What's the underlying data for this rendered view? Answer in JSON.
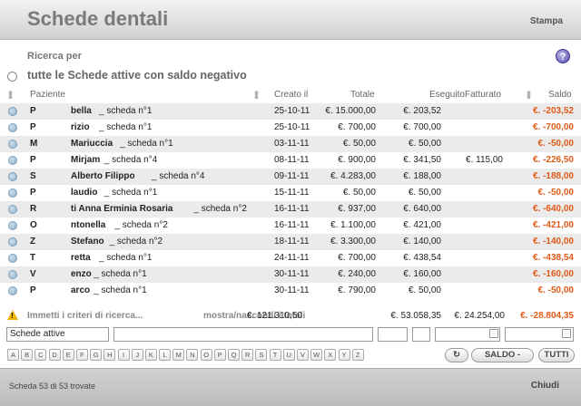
{
  "header": {
    "title": "Schede dentali",
    "print_label": "Stampa"
  },
  "search": {
    "label": "Ricerca per",
    "help_icon": "question-help-icon",
    "option_label": "tutte le Schede attive con saldo negativo"
  },
  "columns": {
    "patient": "Paziente",
    "created": "Creato il",
    "total": "Totale",
    "done": "Eseguito",
    "billed": "Fatturato",
    "balance": "Saldo"
  },
  "rows": [
    {
      "initial": "P",
      "name": "bella",
      "scheda": " _ scheda n°1",
      "created": "25-10-11",
      "total": "€. 15.000,00",
      "done": "€. 203,52",
      "billed": "",
      "balance": "€. -203,52"
    },
    {
      "initial": "P",
      "name": "rizio",
      "scheda": " _ scheda n°1",
      "created": "25-10-11",
      "total": "€. 700,00",
      "done": "€. 700,00",
      "billed": "",
      "balance": "€. -700,00"
    },
    {
      "initial": "M",
      "name": "Mariuccia",
      "scheda": " _ scheda n°1",
      "created": "03-11-11",
      "total": "€. 50,00",
      "done": "€. 50,00",
      "billed": "",
      "balance": "€. -50,00"
    },
    {
      "initial": "P",
      "name": "Mirjam",
      "scheda": " _ scheda n°4",
      "created": "08-11-11",
      "total": "€. 900,00",
      "done": "€. 341,50",
      "billed": "€. 115,00",
      "balance": "€. -226,50"
    },
    {
      "initial": "S",
      "name": "Alberto Filippo",
      "scheda": " _ scheda n°4",
      "created": "09-11-11",
      "total": "€. 4.283,00",
      "done": "€. 188,00",
      "billed": "",
      "balance": "€. -188,00"
    },
    {
      "initial": "P",
      "name": "laudio",
      "scheda": " _ scheda n°1",
      "created": "15-11-11",
      "total": "€. 50,00",
      "done": "€. 50,00",
      "billed": "",
      "balance": "€. -50,00"
    },
    {
      "initial": "R",
      "name": "ti Anna Erminia Rosaria",
      "scheda": " _ scheda n°2",
      "created": "16-11-11",
      "total": "€. 937,00",
      "done": "€. 640,00",
      "billed": "",
      "balance": "€. -640,00"
    },
    {
      "initial": "O",
      "name": "ntonella",
      "scheda": " _ scheda n°2",
      "created": "16-11-11",
      "total": "€. 1.100,00",
      "done": "€. 421,00",
      "billed": "",
      "balance": "€. -421,00"
    },
    {
      "initial": "Z",
      "name": "Stefano",
      "scheda": " _ scheda n°2",
      "created": "18-11-11",
      "total": "€. 3.300,00",
      "done": "€. 140,00",
      "billed": "",
      "balance": "€. -140,00"
    },
    {
      "initial": "T",
      "name": "retta",
      "scheda": " _ scheda n°1",
      "created": "24-11-11",
      "total": "€. 700,00",
      "done": "€. 438,54",
      "billed": "",
      "balance": "€. -438,54"
    },
    {
      "initial": "V",
      "name": "enzo",
      "scheda": " _ scheda n°1",
      "created": "30-11-11",
      "total": "€. 240,00",
      "done": "€. 160,00",
      "billed": "",
      "balance": "€. -160,00"
    },
    {
      "initial": "P",
      "name": "arco",
      "scheda": " _ scheda n°1",
      "created": "30-11-11",
      "total": "€. 790,00",
      "done": "€. 50,00",
      "billed": "",
      "balance": "€. -50,00"
    }
  ],
  "footer": {
    "hint": "Immetti i criteri di ricerca...",
    "toggle_totals": "mostra/nascondi i totali",
    "total": "€. 121.310,50",
    "done": "€. 53.058,35",
    "billed": "€. 24.254,00",
    "balance": "€. -28.804,35"
  },
  "controls": {
    "filter_value": "Schede attive",
    "alphabet": [
      "A",
      "B",
      "C",
      "D",
      "E",
      "F",
      "G",
      "H",
      "I",
      "J",
      "K",
      "L",
      "M",
      "N",
      "O",
      "P",
      "Q",
      "R",
      "S",
      "T",
      "U",
      "V",
      "W",
      "X",
      "Y",
      "Z"
    ],
    "saldo_label": "SALDO -",
    "all_label": "TUTTI"
  },
  "status": {
    "count_text": "Scheda 53 di 53 trovate",
    "close_label": "Chiudi"
  },
  "colors": {
    "balance": "#e05a16",
    "odd_row": "#ebebeb"
  }
}
